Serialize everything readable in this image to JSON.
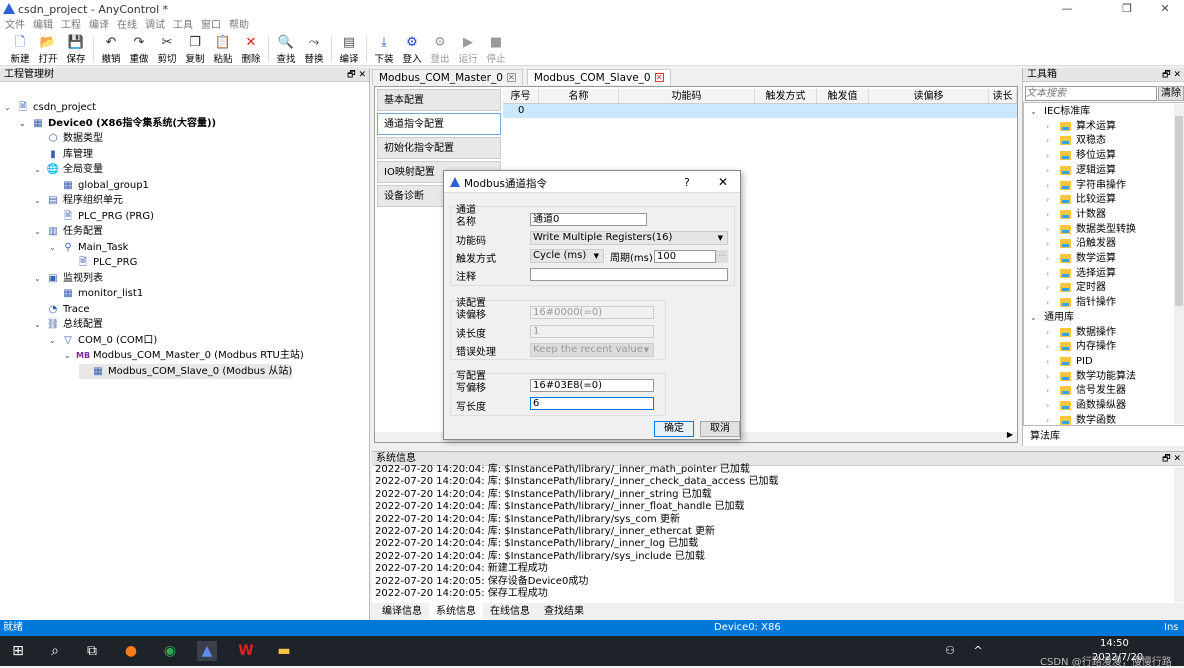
{
  "window": {
    "title": "csdn_project - AnyControl *",
    "minimize": "—",
    "restore": "❐",
    "close": "✕"
  },
  "menu": [
    "文件",
    "编辑",
    "工程",
    "编译",
    "在线",
    "调试",
    "工具",
    "窗口",
    "帮助"
  ],
  "toolbar": [
    {
      "label": "新建",
      "icon": "new-file-icon",
      "g": "🗋",
      "color": "#3a6fd8"
    },
    {
      "label": "打开",
      "icon": "open-folder-icon",
      "g": "📂",
      "color": "#e3a200"
    },
    {
      "label": "保存",
      "icon": "save-icon",
      "g": "💾",
      "color": "#3a4fd8"
    },
    {
      "sep": true
    },
    {
      "label": "撤销",
      "icon": "undo-icon",
      "g": "↶",
      "color": "#333"
    },
    {
      "label": "重做",
      "icon": "redo-icon",
      "g": "↷",
      "color": "#333"
    },
    {
      "label": "剪切",
      "icon": "cut-icon",
      "g": "✂",
      "color": "#333"
    },
    {
      "label": "复制",
      "icon": "copy-icon",
      "g": "❐",
      "color": "#333"
    },
    {
      "label": "粘贴",
      "icon": "paste-icon",
      "g": "📋",
      "color": "#333"
    },
    {
      "label": "删除",
      "icon": "delete-icon",
      "g": "✕",
      "color": "#e02020"
    },
    {
      "sep": true
    },
    {
      "label": "查找",
      "icon": "search-icon",
      "g": "🔍",
      "color": "#333"
    },
    {
      "label": "替换",
      "icon": "replace-icon",
      "g": "⤳",
      "color": "#333"
    },
    {
      "sep": true
    },
    {
      "label": "编译",
      "icon": "compile-icon",
      "g": "▤",
      "color": "#555"
    },
    {
      "sep": true
    },
    {
      "label": "下装",
      "icon": "download-icon",
      "g": "⤓",
      "color": "#2a62d6"
    },
    {
      "label": "登入",
      "icon": "login-icon",
      "g": "⚙",
      "color": "#1a3fd0"
    },
    {
      "label": "登出",
      "icon": "logout-icon",
      "g": "⚙",
      "color": "#999",
      "dis": true
    },
    {
      "label": "运行",
      "icon": "run-icon",
      "g": "▶",
      "color": "#999",
      "dis": true
    },
    {
      "label": "停止",
      "icon": "stop-icon",
      "g": "■",
      "color": "#999",
      "dis": true
    }
  ],
  "project_tree": {
    "title": "工程管理树",
    "items": [
      {
        "label": "csdn_project",
        "level": 0,
        "arrow": "⌄",
        "icon": "project-icon",
        "g": "🗎"
      },
      {
        "label": "Device0 (X86指令集系统(大容量))",
        "level": 1,
        "arrow": "⌄",
        "icon": "device-icon",
        "g": "▦",
        "bold": true
      },
      {
        "label": "数据类型",
        "level": 2,
        "arrow": "",
        "icon": "data-type-icon",
        "g": "⬡"
      },
      {
        "label": "库管理",
        "level": 2,
        "arrow": "",
        "icon": "library-icon",
        "g": "▮"
      },
      {
        "label": "全局变量",
        "level": 2,
        "arrow": "⌄",
        "icon": "globe-icon",
        "g": "🌐"
      },
      {
        "label": "global_group1",
        "level": 3,
        "arrow": "",
        "icon": "table-icon",
        "g": "▦"
      },
      {
        "label": "程序组织单元",
        "level": 2,
        "arrow": "⌄",
        "icon": "pou-icon",
        "g": "▤"
      },
      {
        "label": "PLC_PRG (PRG)",
        "level": 3,
        "arrow": "",
        "icon": "program-icon",
        "g": "🗎"
      },
      {
        "label": "任务配置",
        "level": 2,
        "arrow": "⌄",
        "icon": "task-config-icon",
        "g": "▥"
      },
      {
        "label": "Main_Task",
        "level": 3,
        "arrow": "⌄",
        "icon": "task-icon",
        "g": "⚲"
      },
      {
        "label": "PLC_PRG",
        "level": 4,
        "arrow": "",
        "icon": "program-icon",
        "g": "🗎"
      },
      {
        "label": "监视列表",
        "level": 2,
        "arrow": "⌄",
        "icon": "watch-icon",
        "g": "▣"
      },
      {
        "label": "monitor_list1",
        "level": 3,
        "arrow": "",
        "icon": "table-icon",
        "g": "▦"
      },
      {
        "label": "Trace",
        "level": 2,
        "arrow": "",
        "icon": "trace-icon",
        "g": "◔"
      },
      {
        "label": "总线配置",
        "level": 2,
        "arrow": "⌄",
        "icon": "bus-icon",
        "g": "⛓"
      },
      {
        "label": "COM_0 (COM口)",
        "level": 3,
        "arrow": "⌄",
        "icon": "com-port-icon",
        "g": "▽"
      },
      {
        "label": "Modbus_COM_Master_0 (Modbus RTU主站)",
        "level": 4,
        "arrow": "⌄",
        "icon": "modbus-master-icon",
        "g": "MB"
      },
      {
        "label": "Modbus_COM_Slave_0 (Modbus 从站)",
        "level": 5,
        "arrow": "",
        "icon": "modbus-slave-icon",
        "g": "▦",
        "selected": true
      }
    ]
  },
  "tabs": [
    {
      "label": "Modbus_COM_Master_0",
      "active": false
    },
    {
      "label": "Modbus_COM_Slave_0",
      "active": true
    }
  ],
  "side_menu": [
    {
      "label": "基本配置"
    },
    {
      "label": "通道指令配置",
      "active": true
    },
    {
      "label": "初始化指令配置"
    },
    {
      "label": "IO映射配置"
    },
    {
      "label": "设备诊断"
    }
  ],
  "grid": {
    "columns": [
      "序号",
      "名称",
      "功能码",
      "触发方式",
      "触发值",
      "读偏移",
      "读长"
    ],
    "rows": [
      [
        "0",
        "",
        "",
        "",
        "",
        "",
        ""
      ]
    ]
  },
  "dialog": {
    "title": "Modbus通道指令",
    "help": "?",
    "close": "✕",
    "channel": {
      "group": "通道",
      "name_label": "名称",
      "name_value": "通道0",
      "func_label": "功能码",
      "func_value": "Write Multiple Registers(16)",
      "trigger_label": "触发方式",
      "trigger_value": "Cycle (ms)",
      "period_label": "周期(ms)",
      "period_value": "100",
      "period_btn": "...",
      "comment_label": "注释",
      "comment_value": ""
    },
    "read": {
      "group": "读配置",
      "offset_label": "读偏移",
      "offset_value": "16#0000(=0)",
      "length_label": "读长度",
      "length_value": "1",
      "error_label": "错误处理",
      "error_value": "Keep the recent value"
    },
    "write": {
      "group": "写配置",
      "offset_label": "写偏移",
      "offset_value": "16#03E8(=0)",
      "length_label": "写长度",
      "length_value": "6"
    },
    "ok": "确定",
    "cancel": "取消"
  },
  "toolbox": {
    "title": "工具箱",
    "search_placeholder": "文本搜索",
    "clear": "清除",
    "groups": [
      {
        "label": "IEC标准库",
        "items": [
          "算术运算",
          "双稳态",
          "移位运算",
          "逻辑运算",
          "字符串操作",
          "比较运算",
          "计数器",
          "数据类型转换",
          "沿触发器",
          "数学运算",
          "选择运算",
          "定时器",
          "指针操作"
        ]
      },
      {
        "label": "通用库",
        "items": [
          "数据操作",
          "内存操作",
          "PID",
          "数学功能算法",
          "信号发生器",
          "函数操纵器",
          "数学函数"
        ]
      }
    ],
    "bottom_tab": "算法库"
  },
  "sysinfo": {
    "title": "系统信息",
    "lines": [
      "2022-07-20 14:20:04:  库: $InstancePath/library/_inner_math_pointer  已加载",
      "2022-07-20 14:20:04:  库: $InstancePath/library/_inner_check_data_access  已加载",
      "2022-07-20 14:20:04:  库: $InstancePath/library/_inner_string  已加载",
      "2022-07-20 14:20:04:  库: $InstancePath/library/_inner_float_handle  已加载",
      "2022-07-20 14:20:04:  库: $InstancePath/library/sys_com  更新",
      "2022-07-20 14:20:04:  库: $InstancePath/library/_inner_ethercat  更新",
      "2022-07-20 14:20:04:  库: $InstancePath/library/_inner_log  已加载",
      "2022-07-20 14:20:04:  库: $InstancePath/library/sys_include  已加载",
      "2022-07-20 14:20:04:  新建工程成功",
      "2022-07-20 14:20:05:  保存设备Device0成功",
      "2022-07-20 14:20:05:  保存工程成功"
    ],
    "tabs": [
      "编译信息",
      "系统信息",
      "在线信息",
      "查找结果"
    ],
    "active_tab": 1
  },
  "status": {
    "left": "就绪",
    "center": "Device0: X86",
    "right": "Ins"
  },
  "taskbar": {
    "time": "14:50",
    "date": "2022/7/20",
    "watermark": "CSDN @行路漫漫，慢慢行路"
  },
  "colors": {
    "accent": "#0078d7",
    "selection": "#cce8ff",
    "taskbar": "#1e2229"
  }
}
